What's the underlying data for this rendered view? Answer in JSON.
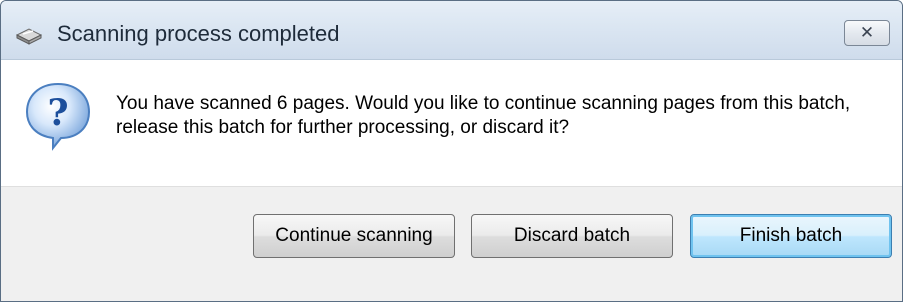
{
  "window": {
    "title": "Scanning process completed",
    "close_symbol": "✕",
    "title_icon": "scanner-icon"
  },
  "dialog": {
    "icon": "question-icon",
    "message": "You have scanned 6 pages. Would you like to continue scanning pages from this batch, release this batch for further processing, or discard it?"
  },
  "buttons": {
    "continue_label": "Continue scanning",
    "discard_label": "Discard batch",
    "finish_label": "Finish batch"
  },
  "colors": {
    "titlebar": "#dbe6f2",
    "content_background": "#ffffff",
    "footer_background": "#f0f0f0",
    "default_button_border": "#3c7fb1",
    "question_icon": "#2a6fc9"
  }
}
